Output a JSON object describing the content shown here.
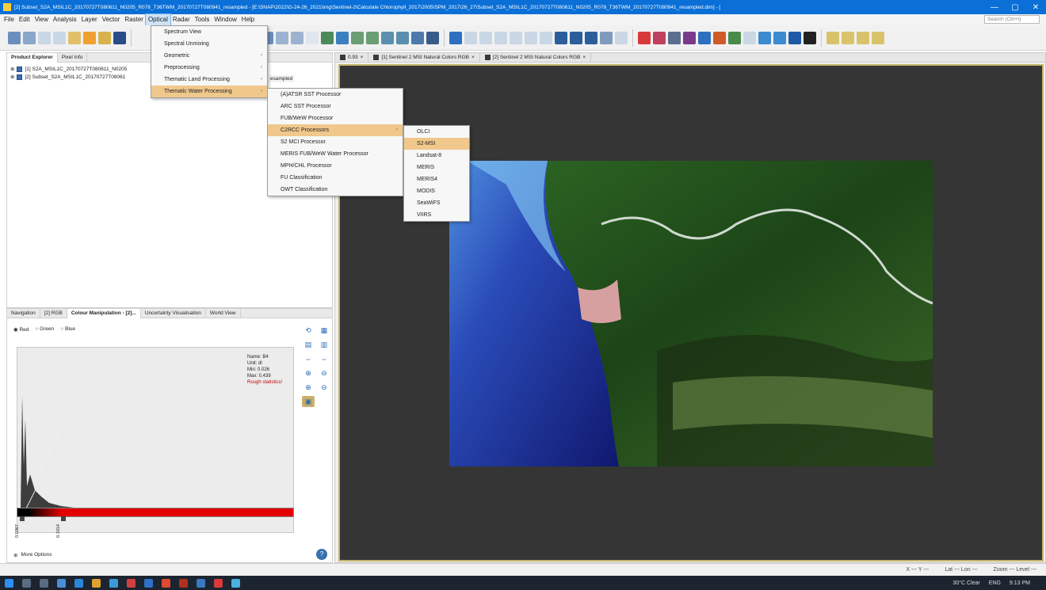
{
  "window": {
    "title": "[2] Subset_S2A_MSIL1C_20170727T080611_N0205_R078_T36TWM_20170727T080941_resampled - [E:\\SNAP\\2022\\G-24-26_2021\\img\\Sentinel-2\\Calculate Chlorophyll_2017\\2005\\SPM_2017\\26_27\\Subset_S2A_MSIL1C_20170727T080611_N0205_R078_T36TWM_20170727T080941_resampled.dim] - [",
    "controls": [
      "—",
      "▢",
      "✕"
    ]
  },
  "menubar": {
    "items": [
      "File",
      "Edit",
      "View",
      "Analysis",
      "Layer",
      "Vector",
      "Raster",
      "Optical",
      "Radar",
      "Tools",
      "Window",
      "Help"
    ],
    "active": "Optical",
    "search_placeholder": "Search (Ctrl+I)"
  },
  "product_explorer": {
    "tabs": [
      "Product Explorer",
      "Pixel Info"
    ],
    "items": [
      "[1] S2A_MSIL1C_20170727T080611_N0205",
      "[2] Subset_S2A_MSIL1C_20170727T08061"
    ],
    "truncated_label": "esampled"
  },
  "colour_panel": {
    "tabs": [
      "Navigation",
      "[2] RGB",
      "Colour Manipulation - [2]...",
      "Uncertainty Visualisation",
      "World View"
    ],
    "channels": [
      "Red",
      "Green",
      "Blue"
    ],
    "selected_channel": "Red",
    "stats": [
      "Name: B4",
      "Unit: dl",
      "Min: 0.026",
      "Max: 0.439"
    ],
    "stats_warning": "Rough statistics!",
    "slider_labels": [
      "0.0367",
      "0.1014"
    ],
    "more_options": "More Options"
  },
  "image_tabs": {
    "zoom": "0.93",
    "tabs": [
      "[1] Sentinel 2 MSI Natural Colors RGB",
      "[2] Sentinel 2 MSI Natural Colors RGB"
    ]
  },
  "optical_menu": {
    "items": [
      {
        "label": "Spectrum View",
        "submenu": false
      },
      {
        "label": "Spectral Unmixing",
        "submenu": false
      },
      {
        "label": "Geometric",
        "submenu": true
      },
      {
        "label": "Preprocessing",
        "submenu": true
      },
      {
        "label": "Thematic Land Processing",
        "submenu": true
      },
      {
        "label": "Thematic Water Processing",
        "submenu": true,
        "highlighted": true
      }
    ]
  },
  "water_menu": {
    "items": [
      {
        "label": "(A)ATSR SST Processor",
        "submenu": false
      },
      {
        "label": "ARC SST Processor",
        "submenu": false
      },
      {
        "label": "FUB/WeW Processor",
        "submenu": false
      },
      {
        "label": "C2RCC Processors",
        "submenu": true,
        "highlighted": true
      },
      {
        "label": "S2 MCI Processor",
        "submenu": false
      },
      {
        "label": "MERIS FUB/WeW Water Processor",
        "submenu": false
      },
      {
        "label": "MPH/CHL Processor",
        "submenu": false
      },
      {
        "label": "FU Classification",
        "submenu": false
      },
      {
        "label": "OWT Classification",
        "submenu": false
      }
    ]
  },
  "c2rcc_menu": {
    "items": [
      "OLCI",
      "S2-MSI",
      "Landsat-8",
      "MERIS",
      "MERIS4",
      "MODIS",
      "SeaWiFS",
      "VIIRS"
    ],
    "highlighted": "S2-MSI"
  },
  "statusbar": {
    "items": [
      "X  ---  Y  ---",
      "Lat  ---  Lon  ---",
      "Zoom ---  Level ---"
    ]
  },
  "taskbar": {
    "weather": "30°C Clear",
    "language": "ENG",
    "time": "9:13 PM"
  },
  "colors": {
    "title_blue": "#0a6fd6",
    "menu_highlight": "#f0c88c",
    "viewport_bg": "#353535",
    "slider_red": "#e30000"
  }
}
